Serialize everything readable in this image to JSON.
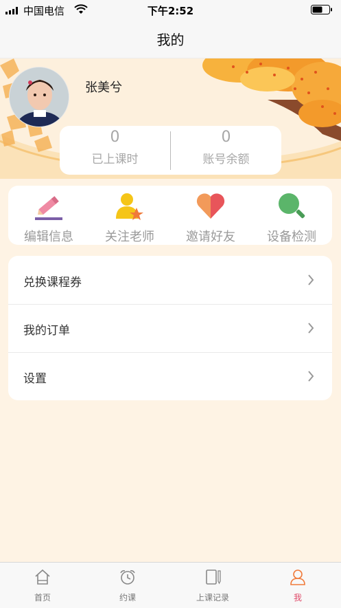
{
  "status_bar": {
    "carrier": "中国电信",
    "time": "下午2:52"
  },
  "nav": {
    "title": "我的"
  },
  "profile": {
    "name": "张美兮"
  },
  "stats": [
    {
      "value": "0",
      "label": "已上课时"
    },
    {
      "value": "0",
      "label": "账号余额"
    }
  ],
  "actions": [
    {
      "label": "编辑信息",
      "icon": "edit-pencil-icon"
    },
    {
      "label": "关注老师",
      "icon": "follow-teacher-icon"
    },
    {
      "label": "邀请好友",
      "icon": "heart-icon"
    },
    {
      "label": "设备检测",
      "icon": "magnifier-icon"
    }
  ],
  "menu": [
    {
      "label": "兑换课程券"
    },
    {
      "label": "我的订单"
    },
    {
      "label": "设置"
    }
  ],
  "tabs": [
    {
      "label": "首页",
      "icon": "home-icon"
    },
    {
      "label": "约课",
      "icon": "alarm-clock-icon"
    },
    {
      "label": "上课记录",
      "icon": "notebook-icon"
    },
    {
      "label": "我",
      "icon": "person-icon",
      "active": true
    }
  ],
  "colors": {
    "accent": "#e04c6a",
    "background": "#fef3e4"
  }
}
